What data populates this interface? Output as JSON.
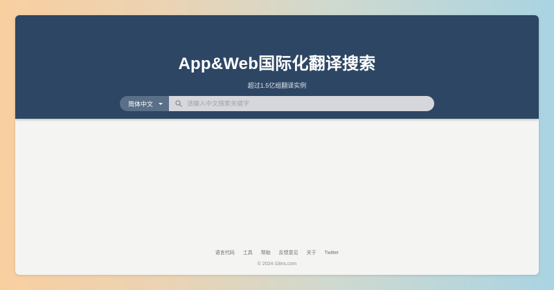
{
  "header": {
    "title": "App&Web国际化翻译搜索",
    "subtitle": "超过1.5亿组翻译实例"
  },
  "search": {
    "language": "简体中文",
    "placeholder": "请输入中文搜索关键字",
    "value": ""
  },
  "footer": {
    "links": [
      {
        "label": "语言代码"
      },
      {
        "label": "工具"
      },
      {
        "label": "帮助"
      },
      {
        "label": "反馈意见"
      },
      {
        "label": "关于"
      },
      {
        "label": "Twitter"
      }
    ],
    "copyright": "© 2024 i18ns.com"
  },
  "colors": {
    "header_bg": "#2d4664",
    "lang_select_bg": "#5a6f88",
    "search_bg": "#d6d7dc",
    "content_bg": "#f4f5f2"
  },
  "icons": {
    "search": "search-icon",
    "dropdown": "chevron-down-icon"
  }
}
